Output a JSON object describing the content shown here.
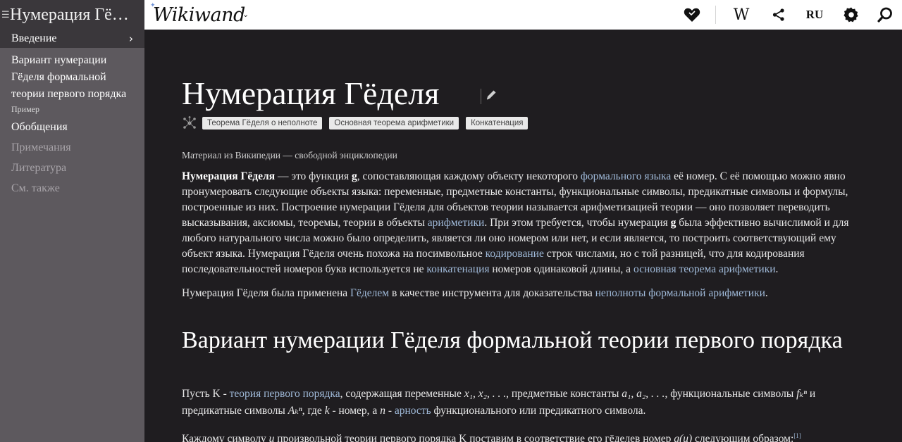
{
  "sidebar": {
    "title": "Нумерация Гё…",
    "items": [
      {
        "label": "Введение",
        "chevron": "›"
      },
      {
        "label": "Вариант нумерации Гёделя формальной теории первого порядка"
      },
      {
        "label": "Пример"
      },
      {
        "label": "Обобщения"
      },
      {
        "label": "Примечания"
      },
      {
        "label": "Литература"
      },
      {
        "label": "См. также"
      }
    ]
  },
  "topbar": {
    "logo": "Wikiwand",
    "language": "RU",
    "icons": [
      "heart-icon",
      "wikipedia-icon",
      "share-icon",
      "language-icon",
      "gear-icon",
      "search-icon"
    ]
  },
  "article": {
    "title": "Нумерация Гёделя",
    "tags": [
      "Теорема Гёделя о неполноте",
      "Основная теорема арифметики",
      "Конкатенация"
    ],
    "source": "Материал из Википедии — свободной энциклопедии",
    "p1": {
      "bold": "Нумерация Гёделя",
      "t1": " — это функция ",
      "g": "g",
      "t2": ", сопоставляющая каждому объекту некоторого ",
      "link1": "формального языка",
      "t3": " её номер. С её помощью можно явно пронумеровать следующие объекты языка: переменные, предметные константы, функциональные символы, предикатные символы и формулы, построенные из них. Построение нумерации Гёделя для объектов теории называется арифметизацией теории — оно позволяет переводить высказывания, аксиомы, теоремы, теории в объекты ",
      "link2": "арифметики",
      "t4": ". При этом требуется, чтобы нумерация ",
      "g2": "g",
      "t5": " была эффективно вычислимой и для любого натурального числа можно было определить, является ли оно номером или нет, и если является, то построить соответствующий ему объект языка. Нумерация Гёделя очень похожа на посимвольное ",
      "link3": "кодирование",
      "t6": " строк числами, но с той разницей, что для кодирования последовательностей номеров букв используется не ",
      "link4": "конкатенация",
      "t7": " номеров одинаковой длины, а ",
      "link5": "основная теорема арифметики",
      "t8": "."
    },
    "p2": {
      "t1": "Нумерация Гёделя была применена ",
      "link1": "Гёделем",
      "t2": " в качестве инструмента для доказательства ",
      "link2": "неполноты формальной арифметики",
      "t3": "."
    },
    "h2": "Вариант нумерации Гёделя формальной теории первого порядка",
    "p3": {
      "t1": "Пусть K - ",
      "link1": "теория первого порядка",
      "t2": ", содержащая переменные ",
      "m1": "x₁, x₂, . . .",
      "t3": ", предметные константы ",
      "m2": "a₁, a₂, . . .",
      "t4": ", функциональные символы ",
      "m3": "fₖⁿ",
      "t5": " и предикатные символы ",
      "m4": "Aₖⁿ",
      "t6": ", где ",
      "m5": "k",
      "t7": " - номер, а ",
      "m6": "n",
      "t8": " - ",
      "link2": "арность",
      "t9": " функционального или предикатного символа."
    },
    "p4": {
      "t1": "Каждому символу ",
      "m1": "u",
      "t2": " произвольной теории первого порядка K поставим в соответствие его гёделев номер ",
      "m2": "g(u)",
      "t3": " следующим образом:",
      "ref": "[1]"
    }
  }
}
